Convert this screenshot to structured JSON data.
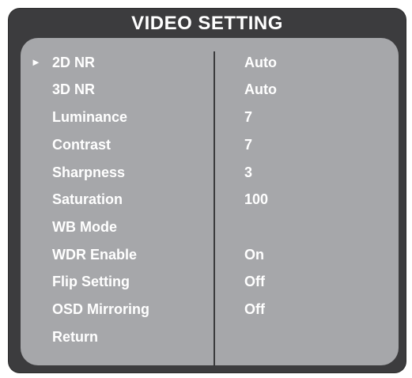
{
  "title": "VIDEO SETTING",
  "cursor_glyph": "►",
  "colors": {
    "frame": "#3c3c3e",
    "panel": "#a6a7aa",
    "text": "#ffffff",
    "divider": "#3a3a3c"
  },
  "menu": [
    {
      "label": "2D NR",
      "value": "Auto",
      "selected": true
    },
    {
      "label": "3D NR",
      "value": "Auto"
    },
    {
      "label": "Luminance",
      "value": "7"
    },
    {
      "label": "Contrast",
      "value": "7"
    },
    {
      "label": "Sharpness",
      "value": "3"
    },
    {
      "label": "Saturation",
      "value": "100"
    },
    {
      "label": "WB Mode",
      "value": ""
    },
    {
      "label": "WDR Enable",
      "value": "On"
    },
    {
      "label": "Flip Setting",
      "value": "Off"
    },
    {
      "label": "OSD Mirroring",
      "value": "Off"
    },
    {
      "label": "Return",
      "value": ""
    }
  ]
}
